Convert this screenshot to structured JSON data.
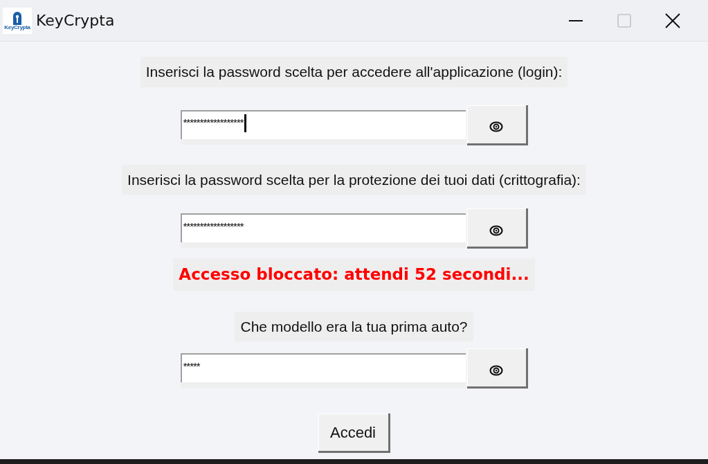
{
  "window": {
    "title": "KeyCrypta",
    "logo_text": "KeyCrypta",
    "controls": [
      {
        "kind": "minimize",
        "disabled": false
      },
      {
        "kind": "maximize",
        "disabled": true
      },
      {
        "kind": "close",
        "disabled": false
      }
    ]
  },
  "items": [
    {
      "kind": "label",
      "text": "Inserisci la password scelta per accedere all'applicazione (login):"
    },
    {
      "kind": "field",
      "value": "******************",
      "focused": true
    },
    {
      "kind": "label",
      "text": "Inserisci la password scelta per la protezione dei tuoi dati (crittografia):"
    },
    {
      "kind": "field",
      "value": "******************",
      "focused": false
    },
    {
      "kind": "error",
      "text": "Accesso bloccato: attendi 52 secondi..."
    },
    {
      "kind": "label",
      "text": "Che modello era la tua prima auto?"
    },
    {
      "kind": "field",
      "value": "*****",
      "focused": false
    },
    {
      "kind": "button",
      "text": "Accedi"
    }
  ]
}
